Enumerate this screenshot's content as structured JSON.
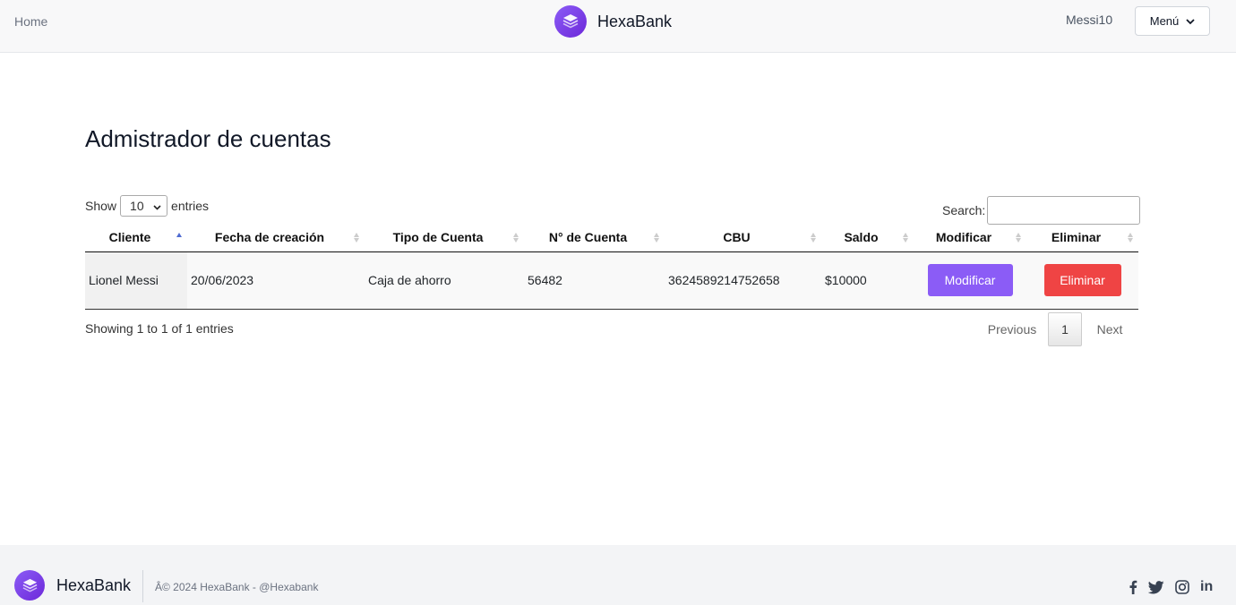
{
  "nav": {
    "home": "Home",
    "brand": "HexaBank",
    "user": "Messi10",
    "menu_label": "Menú"
  },
  "page": {
    "title": "Admistrador de cuentas"
  },
  "table_controls": {
    "show_label": "Show",
    "entries_value": "10",
    "entries_label": "entries",
    "search_label": "Search:",
    "search_value": ""
  },
  "table": {
    "headers": [
      "Cliente",
      "Fecha de creación",
      "Tipo de Cuenta",
      "N° de Cuenta",
      "CBU",
      "Saldo",
      "Modificar",
      "Eliminar"
    ],
    "rows": [
      {
        "cliente": "Lionel Messi",
        "fecha": "20/06/2023",
        "tipo": "Caja de ahorro",
        "numero": "56482",
        "cbu": "3624589214752658",
        "saldo": "$10000",
        "modificar": "Modificar",
        "eliminar": "Eliminar"
      }
    ]
  },
  "pagination": {
    "info": "Showing 1 to 1 of 1 entries",
    "previous": "Previous",
    "current": "1",
    "next": "Next"
  },
  "footer": {
    "brand": "HexaBank",
    "copyright": "Â© 2024 HexaBank  - @Hexabank",
    "social_icons": [
      "facebook-icon",
      "twitter-icon",
      "instagram-icon",
      "linkedin-icon"
    ],
    "linkedin_text": "in"
  },
  "colors": {
    "accent": "#8b5cf6",
    "danger": "#ef4444",
    "navbar_bg": "#f8f8f9",
    "footer_bg": "#f3f4f6"
  }
}
